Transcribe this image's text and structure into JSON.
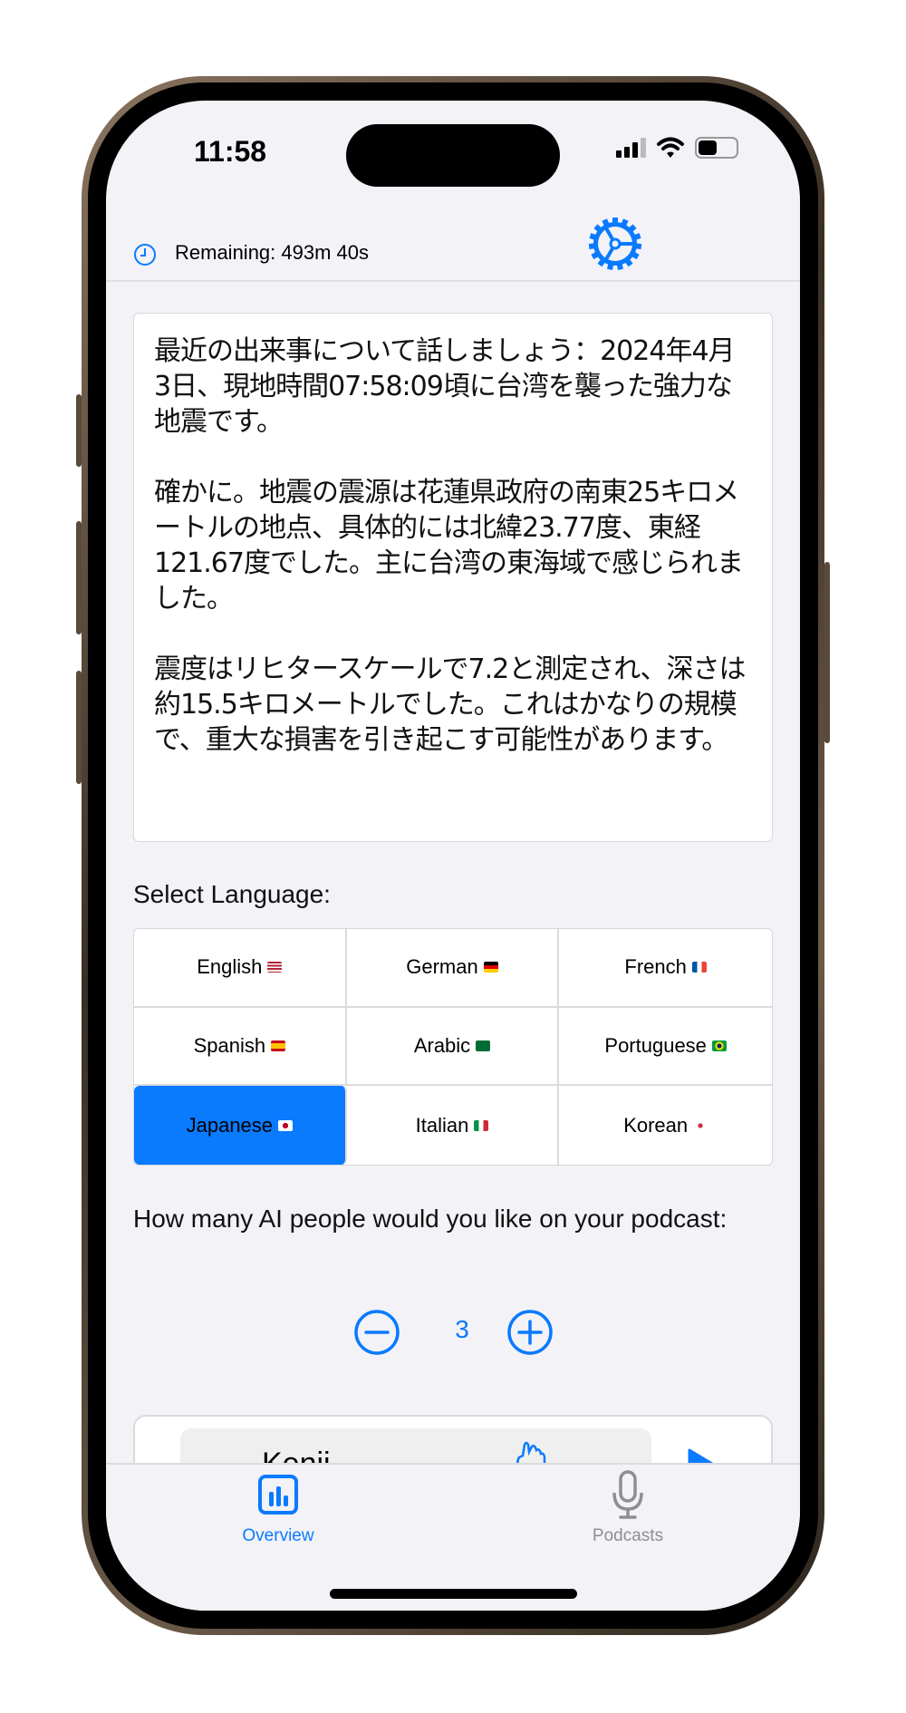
{
  "status_bar": {
    "time": "11:58"
  },
  "header": {
    "remaining": "Remaining: 493m 40s",
    "clock_icon": "clock-icon",
    "settings_icon": "gear-icon"
  },
  "transcript": {
    "paragraphs": [
      "最近の出来事について話しましょう：2024年4月3日、現地時間07:58:09頃に台湾を襲った強力な地震です。",
      "確かに。地震の震源は花蓮県政府の南東25キロメートルの地点、具体的には北緯23.77度、東経121.67度でした。主に台湾の東海域で感じられました。",
      "震度はリヒタースケールで7.2と測定され、深さは約15.5キロメートルでした。これはかなりの規模で、重大な損害を引き起こす可能性があります。"
    ]
  },
  "language": {
    "label": "Select Language:",
    "selected": "Japanese",
    "accent": "#0a7aff",
    "options": [
      {
        "name": "English",
        "flag": "us"
      },
      {
        "name": "German",
        "flag": "de"
      },
      {
        "name": "French",
        "flag": "fr"
      },
      {
        "name": "Spanish",
        "flag": "es"
      },
      {
        "name": "Arabic",
        "flag": "sa"
      },
      {
        "name": "Portuguese",
        "flag": "br"
      },
      {
        "name": "Japanese",
        "flag": "jp"
      },
      {
        "name": "Italian",
        "flag": "it"
      },
      {
        "name": "Korean",
        "flag": "kr"
      }
    ]
  },
  "people": {
    "question": "How many AI people would you like on your podcast:",
    "count": "3"
  },
  "podcast_card": {
    "speaker": "Kenji"
  },
  "tabs": [
    {
      "label": "Overview",
      "active": true
    },
    {
      "label": "Podcasts",
      "active": false
    }
  ]
}
